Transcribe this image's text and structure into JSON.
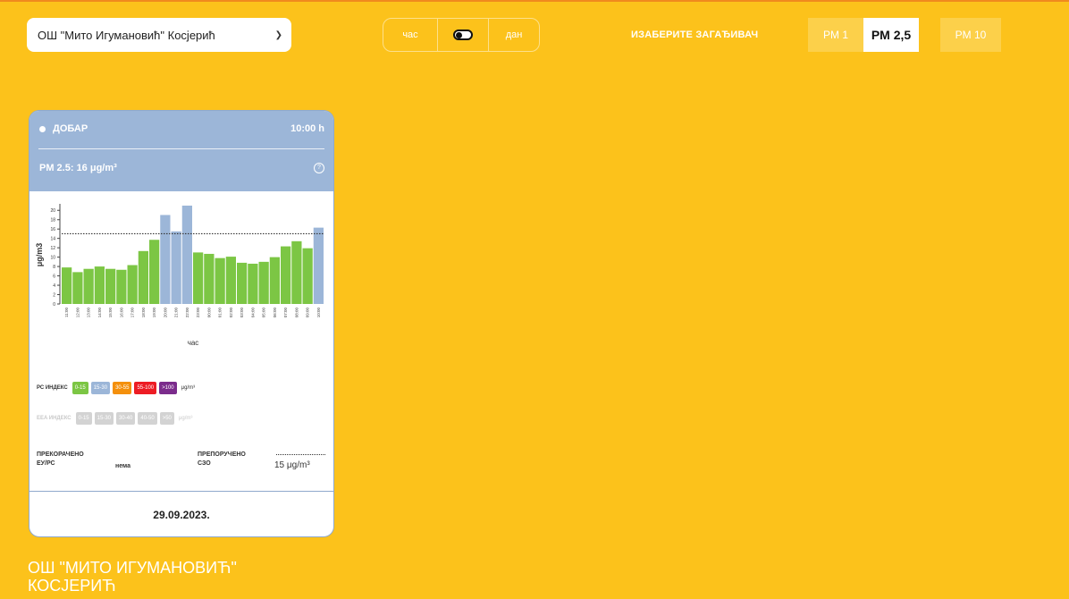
{
  "station": {
    "selected": "ОШ \"Мито Игумановић\" Косјерић"
  },
  "time_toggle": {
    "hour_label": "час",
    "day_label": "дан"
  },
  "pollutant": {
    "label": "ИЗАБЕРИТЕ ЗАГАЂИВАЧ",
    "options": [
      "PM 1",
      "PM 2,5",
      "PM 10"
    ],
    "selected": "PM 2,5"
  },
  "card": {
    "status": "ДОБАР",
    "time": "10:00 h",
    "pm_value": "PM 2.5: 16 μg/m³",
    "legend_rs": {
      "label": "РС ИНДЕКС",
      "chips": [
        {
          "text": "0-15",
          "color": "#7cc644"
        },
        {
          "text": "15-30",
          "color": "#9cb6d8"
        },
        {
          "text": "30-55",
          "color": "#f4900c"
        },
        {
          "text": "55-100",
          "color": "#ed1c24"
        },
        {
          "text": ">100",
          "color": "#7b2c8c"
        }
      ],
      "unit": "μg/m³"
    },
    "legend_eea": {
      "label": "EEA ИНДЕКС",
      "chips": [
        "0-15",
        "15-30",
        "30-40",
        "40-50",
        ">50"
      ],
      "unit": "μg/m³"
    },
    "exceeded_label": "ПРЕКОРАЧЕНО ЕУ/РС",
    "exceeded_value": "нема",
    "recommended_label": "ПРЕПОРУЧЕНО СЗО",
    "recommended_value": "15 μg/m³",
    "date": "29.09.2023."
  },
  "station_title": "ОШ \"МИТО ИГУМАНОВИЋ\" КОСЈЕРИЋ",
  "chart_data": {
    "type": "bar",
    "xlabel": "час",
    "ylabel": "μg/m3",
    "ylim": [
      0,
      21
    ],
    "yticks": [
      0,
      2,
      4,
      6,
      8,
      10,
      12,
      14,
      16,
      18,
      20
    ],
    "threshold": 15,
    "categories": [
      "11:00",
      "12:00",
      "13:00",
      "14:00",
      "15:00",
      "16:00",
      "17:00",
      "18:00",
      "19:00",
      "20:00",
      "21:00",
      "22:00",
      "23:00",
      "00:00",
      "01:00",
      "02:00",
      "03:00",
      "04:00",
      "05:00",
      "06:00",
      "07:00",
      "08:00",
      "09:00",
      "10:00"
    ],
    "values": [
      7.8,
      6.8,
      7.5,
      8,
      7.5,
      7.3,
      8.3,
      11.3,
      13.7,
      19,
      15.5,
      21,
      11,
      10.7,
      9.8,
      10.1,
      8.8,
      8.6,
      9,
      10,
      12.3,
      13.4,
      11.9,
      16.3
    ],
    "colors": [
      "#7cc644",
      "#7cc644",
      "#7cc644",
      "#7cc644",
      "#7cc644",
      "#7cc644",
      "#7cc644",
      "#7cc644",
      "#7cc644",
      "#9cb6d8",
      "#9cb6d8",
      "#9cb6d8",
      "#7cc644",
      "#7cc644",
      "#7cc644",
      "#7cc644",
      "#7cc644",
      "#7cc644",
      "#7cc644",
      "#7cc644",
      "#7cc644",
      "#7cc644",
      "#7cc644",
      "#9cb6d8"
    ]
  }
}
